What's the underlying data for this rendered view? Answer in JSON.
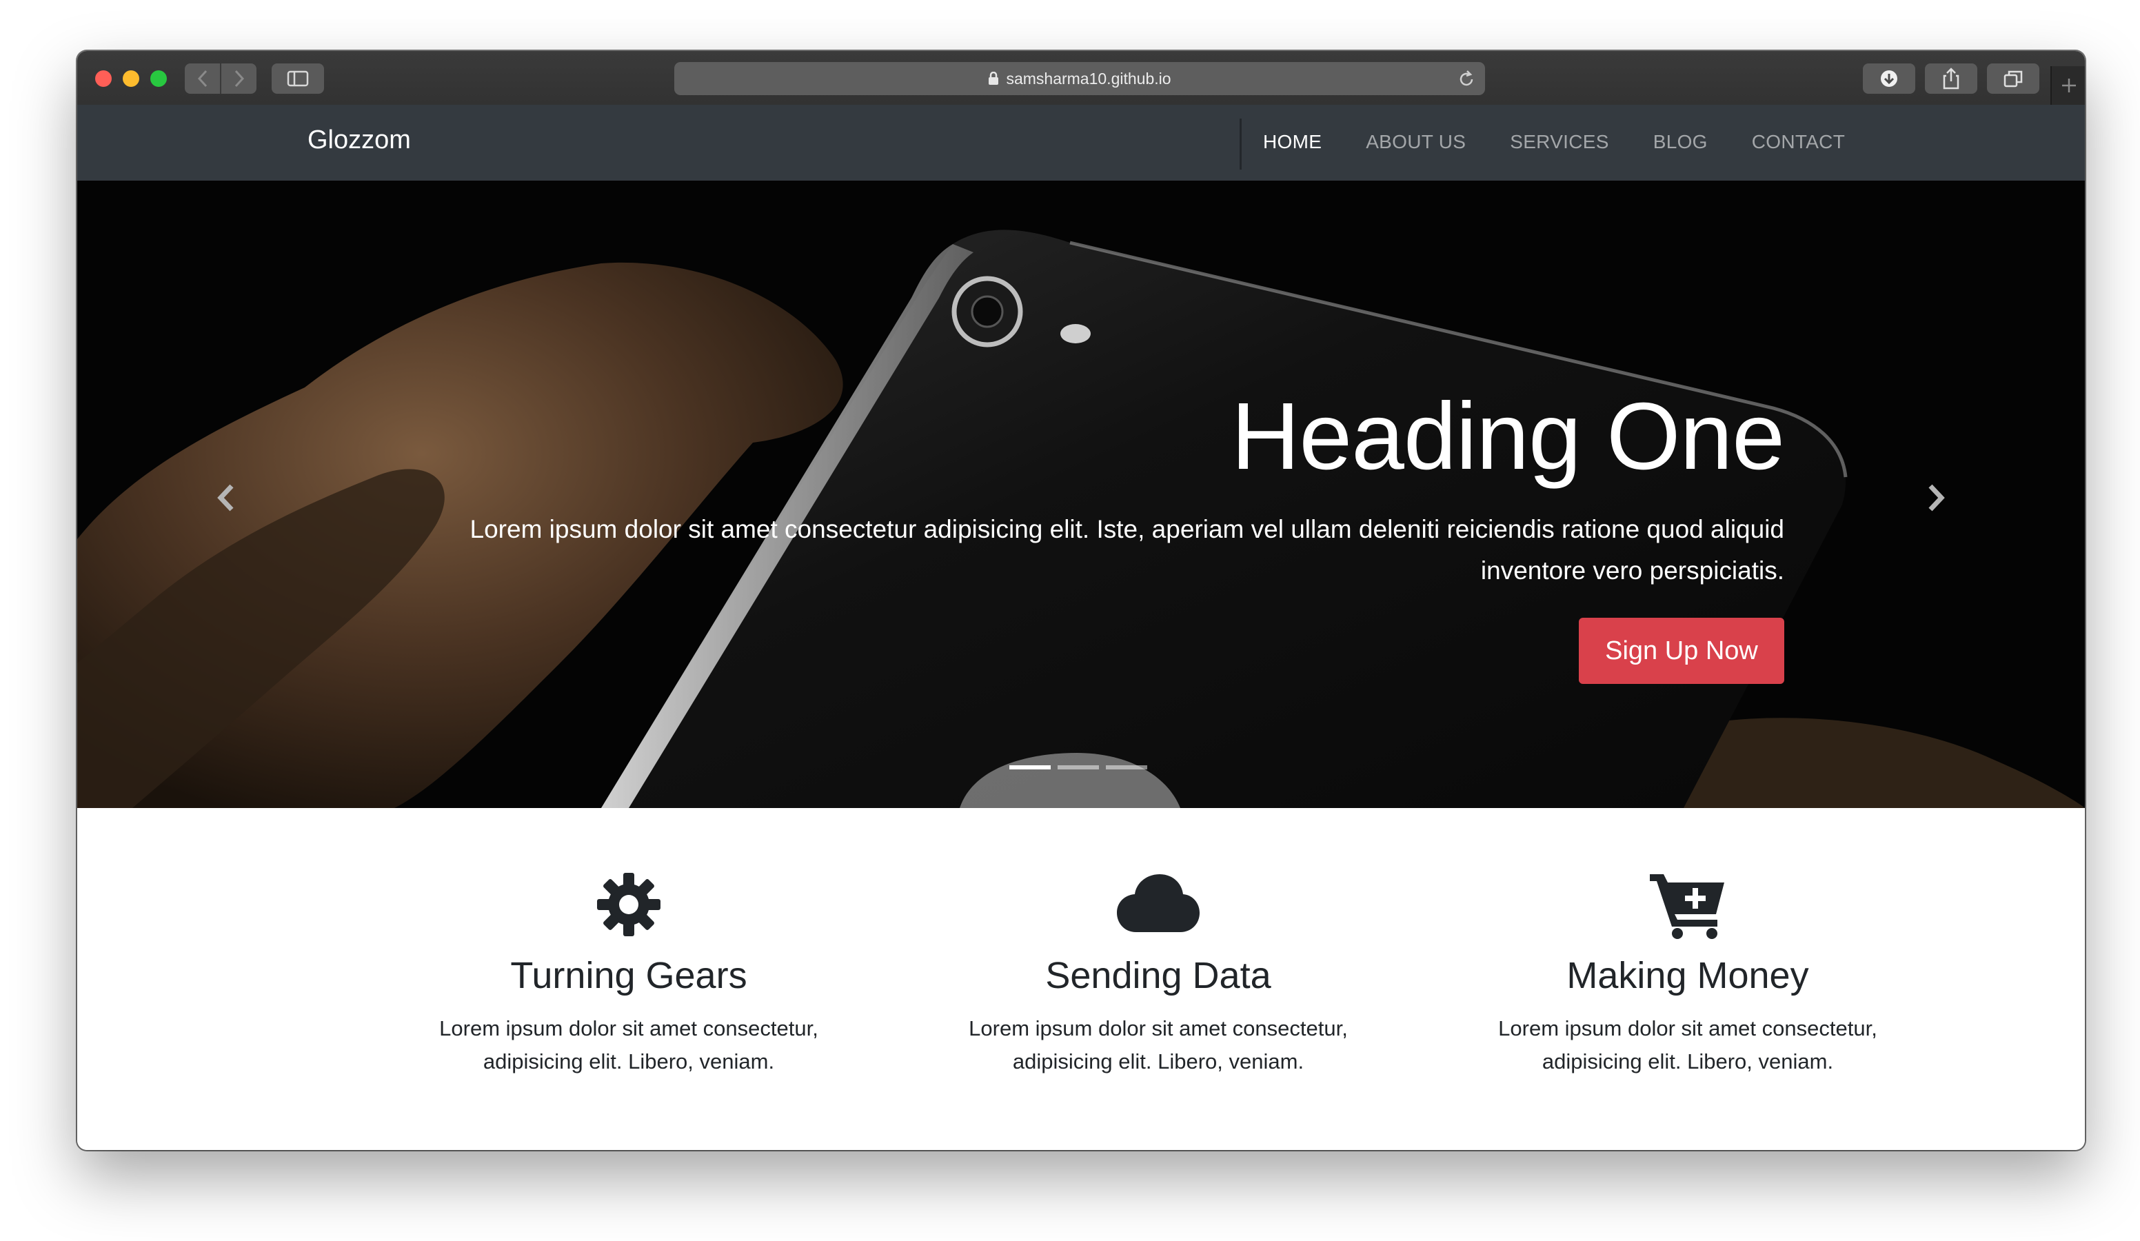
{
  "browser": {
    "url": "samsharma10.github.io"
  },
  "site": {
    "brand": "Glozzom",
    "nav": [
      {
        "label": "HOME",
        "active": true
      },
      {
        "label": "ABOUT US",
        "active": false
      },
      {
        "label": "SERVICES",
        "active": false
      },
      {
        "label": "BLOG",
        "active": false
      },
      {
        "label": "CONTACT",
        "active": false
      }
    ]
  },
  "hero": {
    "heading": "Heading One",
    "text_line1": "Lorem ipsum dolor sit amet consectetur adipisicing elit. Iste, aperiam vel ullam deleniti reiciendis ratione quod aliquid",
    "text_line2": "inventore vero perspiciatis.",
    "cta": "Sign Up Now",
    "cta_color": "#d9414b",
    "slides_count": 3,
    "active_slide": 1
  },
  "features": [
    {
      "icon": "gear-icon",
      "title": "Turning Gears",
      "desc_line1": "Lorem ipsum dolor sit amet consectetur,",
      "desc_line2": "adipisicing elit. Libero, veniam."
    },
    {
      "icon": "cloud-icon",
      "title": "Sending Data",
      "desc_line1": "Lorem ipsum dolor sit amet consectetur,",
      "desc_line2": "adipisicing elit. Libero, veniam."
    },
    {
      "icon": "cart-plus-icon",
      "title": "Making Money",
      "desc_line1": "Lorem ipsum dolor sit amet consectetur,",
      "desc_line2": "adipisicing elit. Libero, veniam."
    }
  ],
  "colors": {
    "navbar": "#343a40",
    "text_dark": "#212529"
  }
}
